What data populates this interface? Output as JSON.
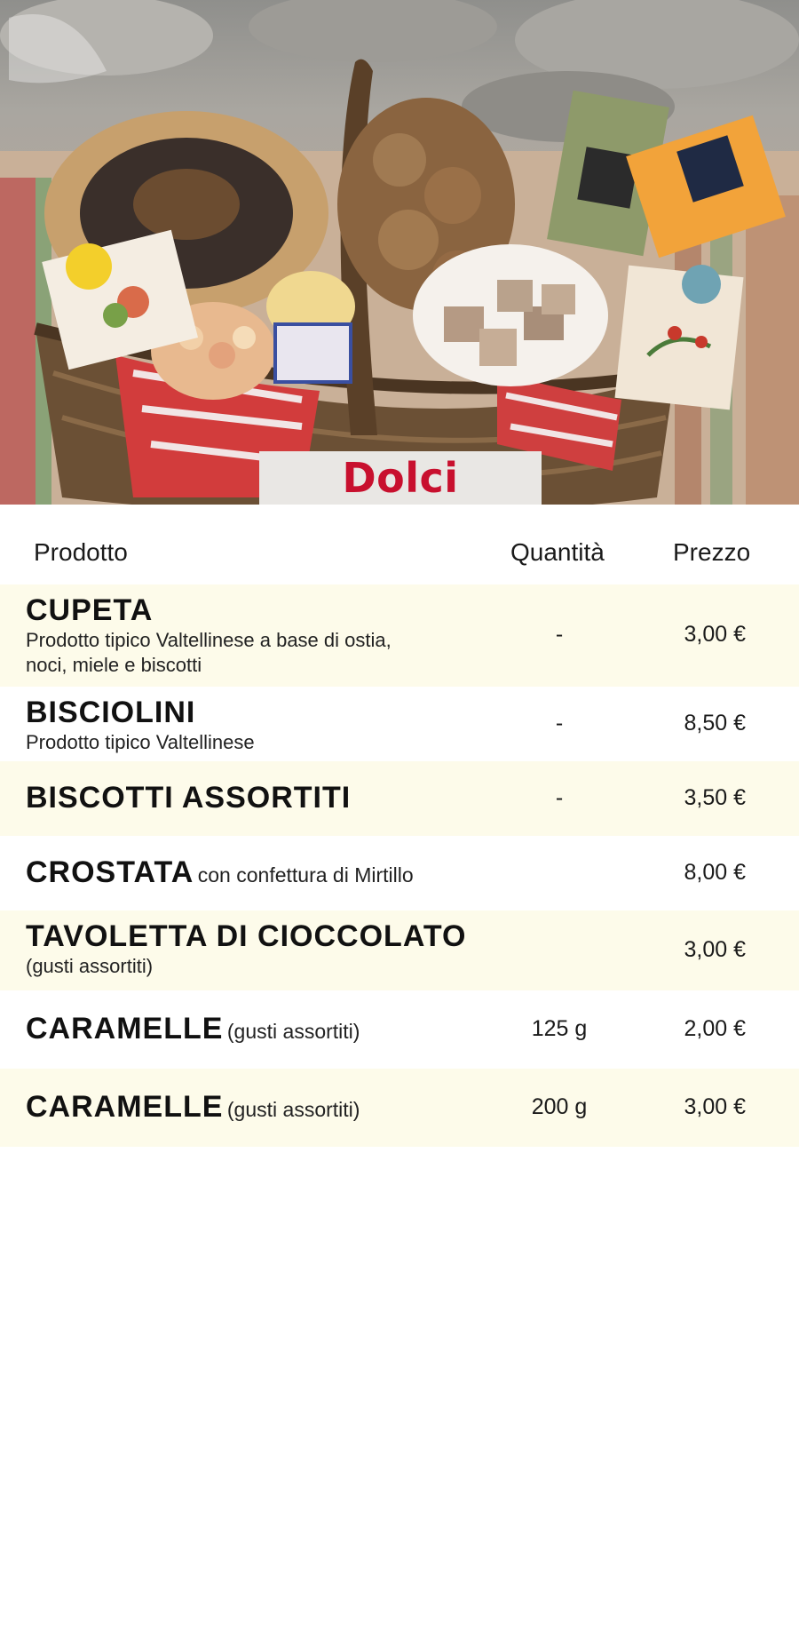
{
  "hero": {
    "title": "Dolci"
  },
  "table": {
    "headers": {
      "product": "Prodotto",
      "quantity": "Quantità",
      "price": "Prezzo"
    },
    "rows": [
      {
        "name": "CUPETA",
        "inline_desc": "",
        "desc": "Prodotto tipico Valtellinese a base di ostia, noci, miele e biscotti",
        "quantity": "-",
        "price": "3,00 €"
      },
      {
        "name": "BISCIOLINI",
        "inline_desc": "",
        "desc": "Prodotto tipico Valtellinese",
        "quantity": "-",
        "price": "8,50 €"
      },
      {
        "name": "BISCOTTI ASSORTITI",
        "inline_desc": "",
        "desc": "",
        "quantity": "-",
        "price": "3,50 €"
      },
      {
        "name": "CROSTATA",
        "inline_desc": "con confettura di Mirtillo",
        "desc": "",
        "quantity": "",
        "price": "8,00 €"
      },
      {
        "name": "TAVOLETTA DI CIOCCOLATO",
        "inline_desc": "",
        "desc": "(gusti assortiti)",
        "quantity": "",
        "price": "3,00 €"
      },
      {
        "name": "CARAMELLE",
        "inline_desc": "(gusti assortiti)",
        "desc": "",
        "quantity": "125 g",
        "price": "2,00 €"
      },
      {
        "name": "CARAMELLE",
        "inline_desc": "(gusti assortiti)",
        "desc": "",
        "quantity": "200 g",
        "price": "3,00 €"
      }
    ]
  },
  "colors": {
    "title_red": "#c8102e",
    "row_alt_bg": "#fdfbea"
  }
}
